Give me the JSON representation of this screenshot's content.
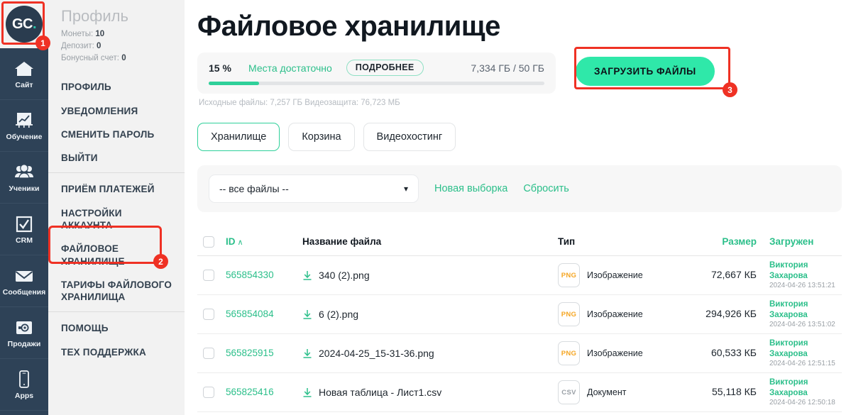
{
  "rail": {
    "logo": {
      "part1": "GC",
      "part2": ".",
      "name": "getcourse-logo"
    },
    "items": [
      {
        "label": "Сайт",
        "icon": "home-icon"
      },
      {
        "label": "Обучение",
        "icon": "chart-board-icon"
      },
      {
        "label": "Ученики",
        "icon": "users-icon"
      },
      {
        "label": "CRM",
        "icon": "checkbox-check-icon"
      },
      {
        "label": "Сообщения",
        "icon": "envelope-icon"
      },
      {
        "label": "Продажи",
        "icon": "safe-box-icon"
      },
      {
        "label": "Apps",
        "icon": "mobile-phone-icon"
      }
    ]
  },
  "sidemenu": {
    "profile_title": "Профиль",
    "stats": [
      {
        "label": "Монеты:",
        "value": "10"
      },
      {
        "label": "Депозит:",
        "value": "0"
      },
      {
        "label": "Бонусный счет:",
        "value": "0"
      }
    ],
    "group1": [
      "ПРОФИЛЬ",
      "УВЕДОМЛЕНИЯ",
      "СМЕНИТЬ ПАРОЛЬ",
      "ВЫЙТИ"
    ],
    "group2": [
      "ПРИЁМ ПЛАТЕЖЕЙ",
      "НАСТРОЙКИ АККАУНТА",
      "ФАЙЛОВОЕ ХРАНИЛИЩЕ",
      "ТАРИФЫ ФАЙЛОВОГО ХРАНИЛИЩА"
    ],
    "group3": [
      "ПОМОЩЬ",
      "ТЕХ ПОДДЕРЖКА"
    ]
  },
  "main": {
    "page_title": "Файловое хранилище",
    "storage": {
      "percent_label": "15 %",
      "percent_value": 15,
      "status": "Места достаточно",
      "more_button": "ПОДРОБНЕЕ",
      "quota": "7,334 ГБ / 50 ГБ",
      "note": "Исходные файлы: 7,257 ГБ Видеозащита: 76,723 МБ"
    },
    "upload_button": "ЗАГРУЗИТЬ ФАЙЛЫ",
    "tabs": [
      {
        "label": "Хранилище",
        "active": true
      },
      {
        "label": "Корзина",
        "active": false
      },
      {
        "label": "Видеохостинг",
        "active": false
      }
    ],
    "filter": {
      "select_value": "-- все файлы --",
      "chevron": "chevron-down-icon",
      "link_new": "Новая выборка",
      "link_reset": "Сбросить"
    },
    "table": {
      "headers": {
        "id": "ID",
        "sort_arrow": "∧",
        "name": "Название файла",
        "type": "Тип",
        "size": "Размер",
        "uploaded": "Загружен"
      },
      "rows": [
        {
          "id": "565854330",
          "name": "340 (2).png",
          "badge": "PNG",
          "badge_kind": "png",
          "type": "Изображение",
          "size": "72,667 КБ",
          "user": "Виктория Захарова",
          "date": "2024-04-26 13:51:21"
        },
        {
          "id": "565854084",
          "name": "6 (2).png",
          "badge": "PNG",
          "badge_kind": "png",
          "type": "Изображение",
          "size": "294,926 КБ",
          "user": "Виктория Захарова",
          "date": "2024-04-26 13:51:02"
        },
        {
          "id": "565825915",
          "name": "2024-04-25_15-31-36.png",
          "badge": "PNG",
          "badge_kind": "png",
          "type": "Изображение",
          "size": "60,533 КБ",
          "user": "Виктория Захарова",
          "date": "2024-04-26 12:51:15"
        },
        {
          "id": "565825416",
          "name": "Новая таблица - Лист1.csv",
          "badge": "CSV",
          "badge_kind": "csv",
          "type": "Документ",
          "size": "55,118 КБ",
          "user": "Виктория Захарова",
          "date": "2024-04-26 12:50:18"
        }
      ]
    }
  },
  "annotations": [
    {
      "number": "1",
      "target": "logo"
    },
    {
      "number": "2",
      "target": "file-storage-menu-item"
    },
    {
      "number": "3",
      "target": "upload-files-button"
    }
  ],
  "colors": {
    "accent_green": "#2bbf8a",
    "button_green": "#2fe8a9",
    "rail_navy": "#2e4257",
    "annotation_red": "#ef3124",
    "png_orange": "#f5a623"
  }
}
